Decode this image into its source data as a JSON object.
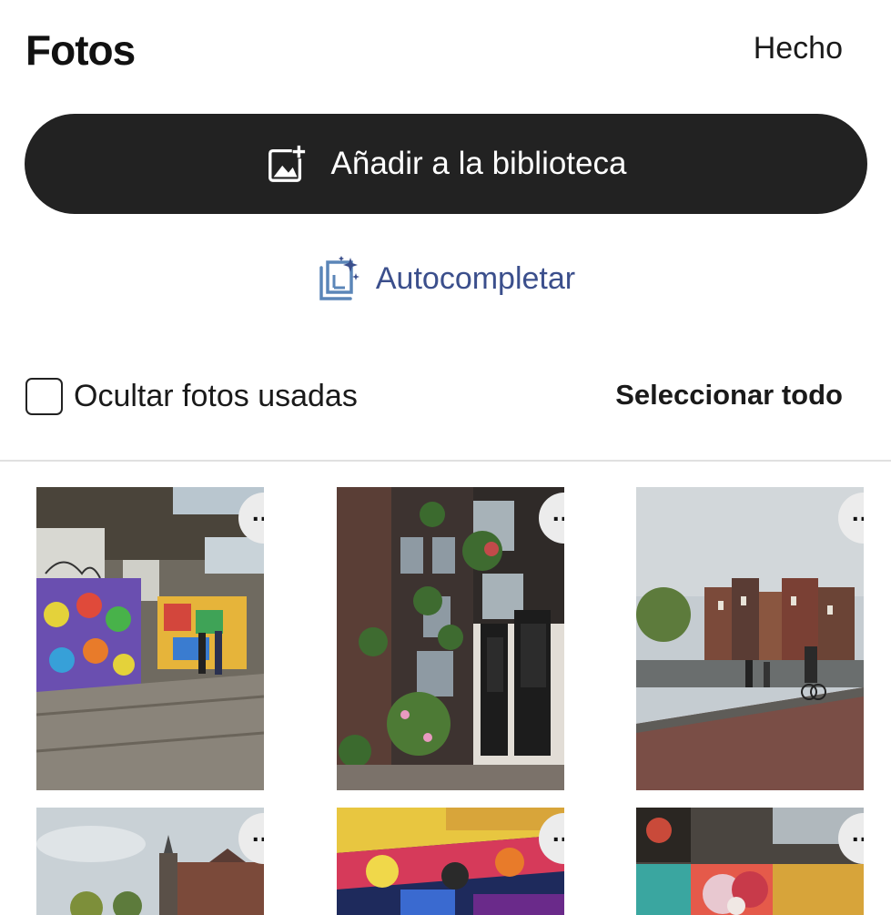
{
  "header": {
    "title": "Fotos",
    "done_label": "Hecho"
  },
  "add_button": {
    "label": "Añadir a la biblioteca",
    "icon": "add-photo-icon"
  },
  "autocomplete": {
    "label": "Autocompletar",
    "icon": "sparkle-library-icon",
    "color": "#3b4f8c"
  },
  "filters": {
    "hide_used_label": "Ocultar fotos usadas",
    "hide_used_checked": false,
    "select_all_label": "Seleccionar todo"
  },
  "photos": [
    {
      "name": "photo-street-art-hall",
      "more_label": "..."
    },
    {
      "name": "photo-canal-house-facade",
      "more_label": "..."
    },
    {
      "name": "photo-bridge-cyclist",
      "more_label": "..."
    },
    {
      "name": "photo-canal-church",
      "more_label": "..."
    },
    {
      "name": "photo-graffiti-ceiling",
      "more_label": "..."
    },
    {
      "name": "photo-flower-mural",
      "more_label": "..."
    }
  ]
}
